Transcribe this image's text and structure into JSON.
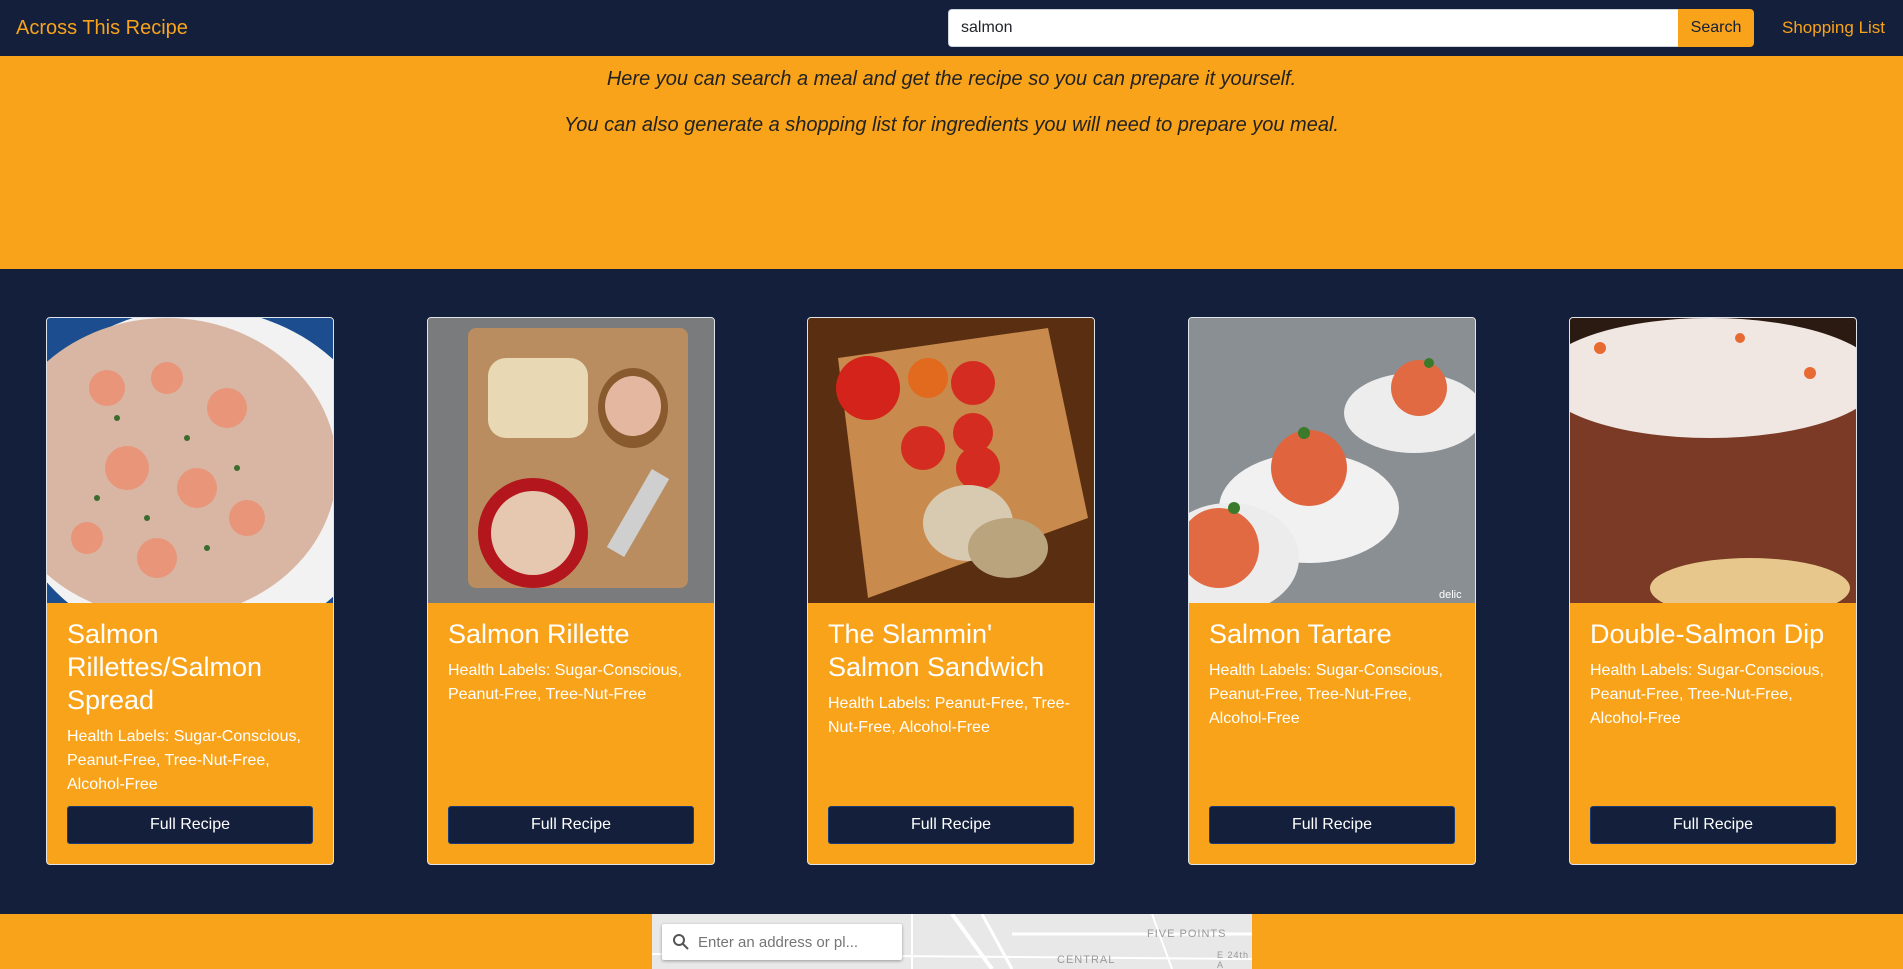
{
  "header": {
    "brand": "Across This Recipe",
    "search_value": "salmon",
    "search_button": "Search",
    "shopping_link": "Shopping List"
  },
  "hero": {
    "line1": "Here you can search a meal and get the recipe so you can prepare it yourself.",
    "line2": "You can also generate a shopping list for ingredients you will need to prepare you meal."
  },
  "cards": [
    {
      "title": "Salmon Rillettes/Salmon Spread",
      "labels": "Health Labels: Sugar-Conscious, Peanut-Free, Tree-Nut-Free, Alcohol-Free",
      "button": "Full Recipe"
    },
    {
      "title": "Salmon Rillette",
      "labels": "Health Labels: Sugar-Conscious, Peanut-Free, Tree-Nut-Free",
      "button": "Full Recipe"
    },
    {
      "title": "The Slammin' Salmon Sandwich",
      "labels": "Health Labels: Peanut-Free, Tree-Nut-Free, Alcohol-Free",
      "button": "Full Recipe"
    },
    {
      "title": "Salmon Tartare",
      "labels": "Health Labels: Sugar-Conscious, Peanut-Free, Tree-Nut-Free, Alcohol-Free",
      "button": "Full Recipe"
    },
    {
      "title": "Double-Salmon Dip",
      "labels": "Health Labels: Sugar-Conscious, Peanut-Free, Tree-Nut-Free, Alcohol-Free",
      "button": "Full Recipe"
    }
  ],
  "map": {
    "search_placeholder": "Enter an address or pl...",
    "labels": [
      "FIVE POINTS",
      "CENTRAL",
      "E 24th A"
    ]
  },
  "colors": {
    "navy": "#131f3b",
    "orange": "#f9a31a"
  }
}
